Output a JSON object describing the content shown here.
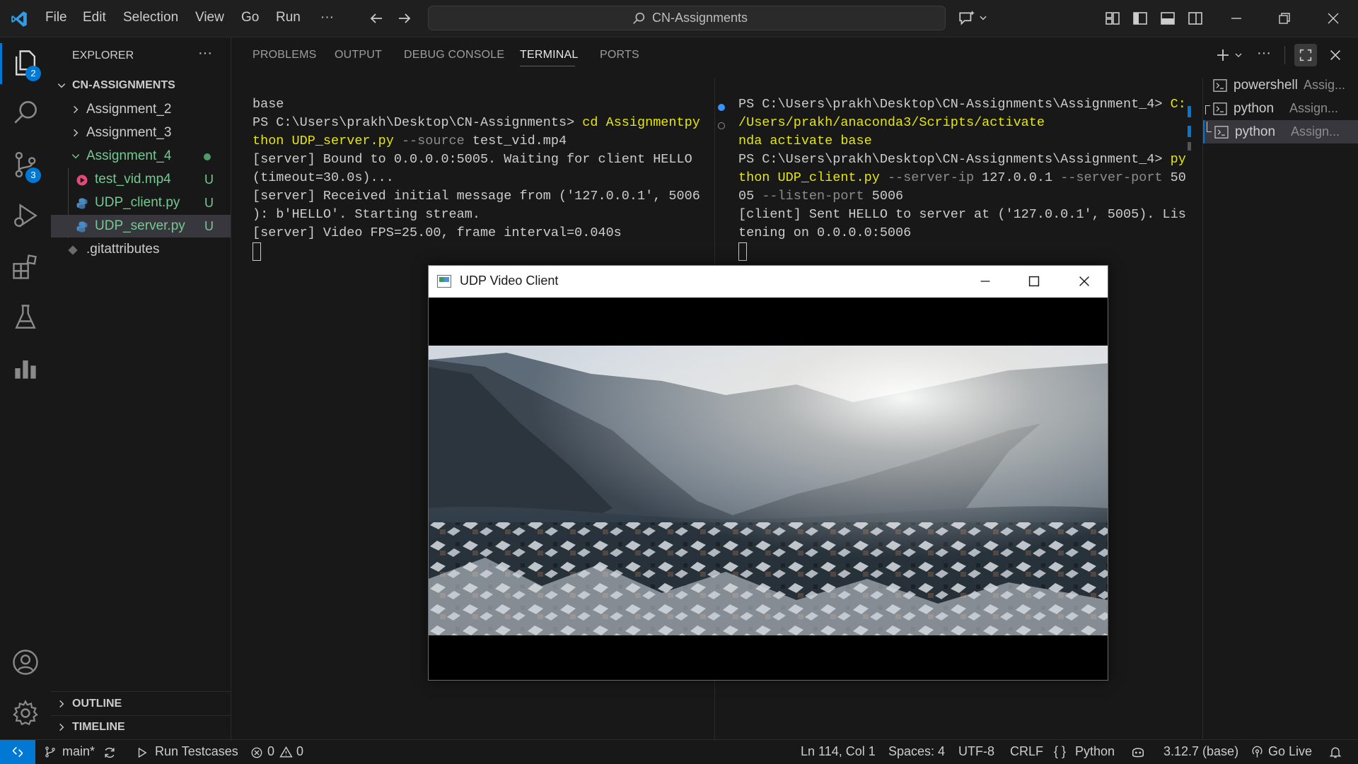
{
  "titlebar": {
    "menu": [
      "File",
      "Edit",
      "Selection",
      "View",
      "Go",
      "Run",
      "···"
    ],
    "search_text": "CN-Assignments"
  },
  "activity": {
    "explorer_badge": "2",
    "scm_badge": "3"
  },
  "sidebar": {
    "title": "EXPLORER",
    "more": "···",
    "root": "CN-ASSIGNMENTS",
    "items": [
      {
        "label": "Assignment_2"
      },
      {
        "label": "Assignment_3"
      },
      {
        "label": "Assignment_4"
      },
      {
        "label": "test_vid.mp4",
        "status": "U"
      },
      {
        "label": "UDP_client.py",
        "status": "U"
      },
      {
        "label": "UDP_server.py",
        "status": "U"
      },
      {
        "label": ".gitattributes"
      }
    ],
    "outline": "OUTLINE",
    "timeline": "TIMELINE"
  },
  "panel": {
    "tabs": [
      "PROBLEMS",
      "OUTPUT",
      "DEBUG CONSOLE",
      "TERMINAL",
      "PORTS"
    ],
    "more": "···"
  },
  "terminal_left": {
    "l1": "base",
    "l2a": "PS C:\\Users\\prakh\\Desktop\\CN-Assignments> ",
    "l2b": "cd Assignmentpy",
    "l3a": "thon UDP_server.py ",
    "l3b": "--source ",
    "l3c": "test_vid.mp4",
    "l4": "[server] Bound to 0.0.0.0:5005. Waiting for client HELLO",
    "l5": "(timeout=30.0s)...",
    "l6": "[server] Received initial message from ('127.0.0.1', 5006",
    "l7": "): b'HELLO'. Starting stream.",
    "l8": "[server] Video FPS=25.00, frame interval=0.040s"
  },
  "terminal_right": {
    "l1a": "PS C:\\Users\\prakh\\Desktop\\CN-Assignments\\Assignment_4> ",
    "l1b": "C:",
    "l2": "/Users/prakh/anaconda3/Scripts/activate",
    "l3": "nda activate base",
    "l4a": "PS C:\\Users\\prakh\\Desktop\\CN-Assignments\\Assignment_4> ",
    "l4b": "py",
    "l5a": "thon UDP_client.py ",
    "l5b": "--server-ip ",
    "l5c": "127.0.0.1 ",
    "l5d": "--server-port ",
    "l5e": "50",
    "l6a": "05 ",
    "l6b": "--listen-port ",
    "l6c": "5006",
    "l7": "[client] Sent HELLO to server at ('127.0.0.1', 5005). Lis",
    "l8": "tening on 0.0.0.0:5006"
  },
  "terminal_list": [
    {
      "name": "powershell",
      "folder": "Assig..."
    },
    {
      "name": "python",
      "folder": "Assign..."
    },
    {
      "name": "python",
      "folder": "Assign..."
    }
  ],
  "video_window": {
    "title": "UDP Video Client"
  },
  "statusbar": {
    "branch": "main*",
    "run_testcases": "Run Testcases",
    "errors": "0",
    "warnings": "0",
    "position": "Ln 114, Col 1",
    "spaces": "Spaces: 4",
    "encoding": "UTF-8",
    "eol": "CRLF",
    "language": "Python",
    "interpreter": "3.12.7 (base)",
    "go_live": "Go Live"
  },
  "colors": {
    "accent": "#0078d4",
    "untracked": "#73c991",
    "terminal_yellow": "#e5e510"
  }
}
